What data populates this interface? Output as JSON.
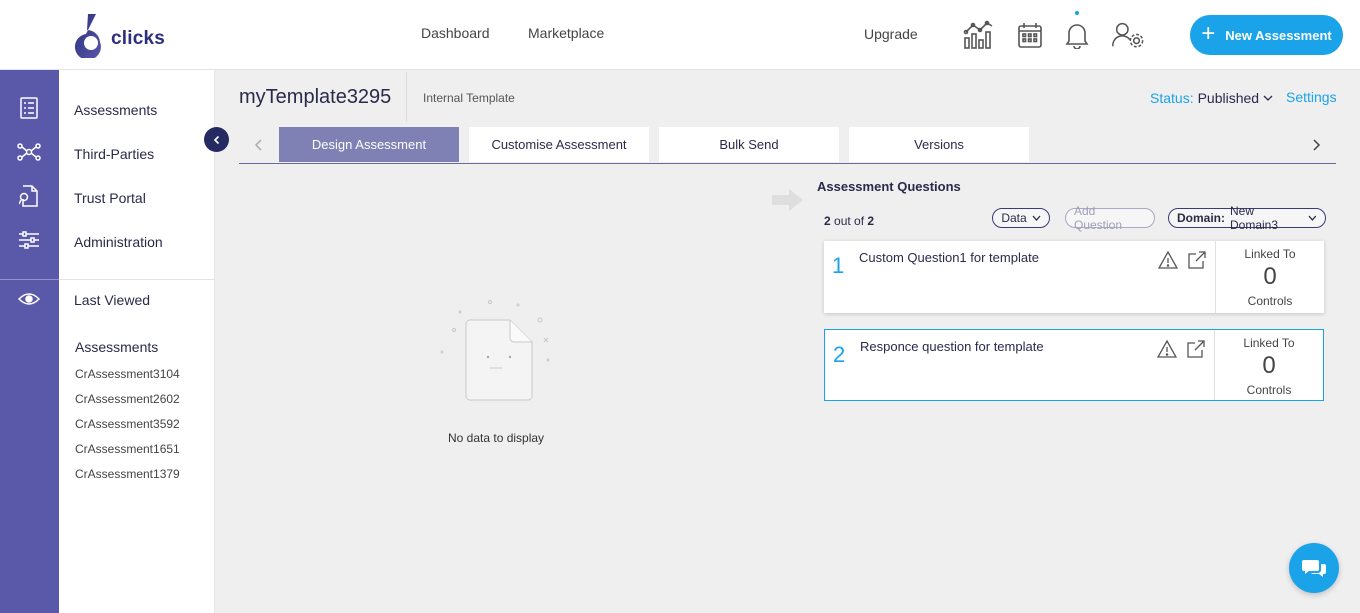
{
  "header": {
    "logo_text": "clicks",
    "nav": [
      "Dashboard",
      "Marketplace"
    ],
    "upgrade": "Upgrade",
    "icons": [
      "analytics-icon",
      "calendar-icon",
      "bell-icon",
      "user-settings-icon"
    ],
    "new_assessment": "New Assessment",
    "accent": "#1aa3e8"
  },
  "rail": {
    "icons": [
      "assessments-icon",
      "third-parties-icon",
      "trust-portal-icon",
      "administration-icon",
      "eye-icon"
    ],
    "color": "#5a58a8"
  },
  "sidebar": {
    "items": [
      "Assessments",
      "Third-Parties",
      "Trust Portal",
      "Administration"
    ],
    "last_viewed": "Last Viewed",
    "recent_group": "Assessments",
    "recent": [
      "CrAssessment3104",
      "CrAssessment2602",
      "CrAssessment3592",
      "CrAssessment1651",
      "CrAssessment1379"
    ]
  },
  "page": {
    "title": "myTemplate3295",
    "type": "Internal Template",
    "status_label": "Status:",
    "status_value": "Published",
    "settings": "Settings"
  },
  "tabs": [
    {
      "label": "Design Assessment",
      "active": true
    },
    {
      "label": "Customise Assessment",
      "active": false
    },
    {
      "label": "Bulk Send",
      "active": false
    },
    {
      "label": "Versions",
      "active": false
    }
  ],
  "empty": {
    "text": "No data to display"
  },
  "questions": {
    "title": "Assessment Questions",
    "count_shown": "2",
    "count_sep": "out of",
    "count_total": "2",
    "data_btn": "Data",
    "add_btn": "Add Question",
    "domain_key": "Domain:",
    "domain_value": "New Domain3",
    "items": [
      {
        "number": "1",
        "text": "Custom Question1 for template",
        "linked_label": "Linked To",
        "linked_count": "0",
        "linked_unit": "Controls"
      },
      {
        "number": "2",
        "text": "Responce question for template",
        "linked_label": "Linked To",
        "linked_count": "0",
        "linked_unit": "Controls"
      }
    ]
  }
}
